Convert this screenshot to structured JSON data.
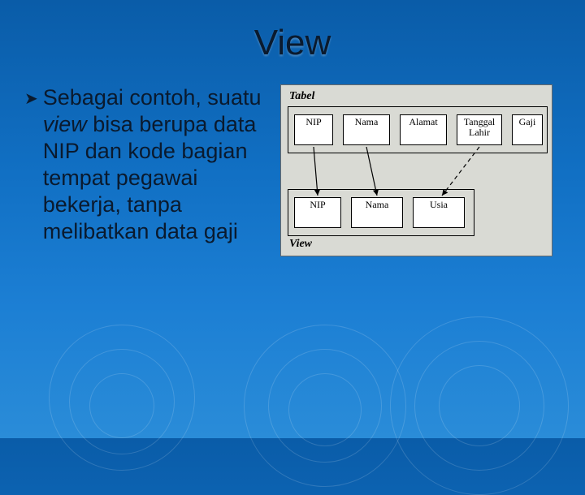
{
  "title": "View",
  "bullet": {
    "lead": "Sebagai contoh, suatu ",
    "italic": "view",
    "rest": " bisa berupa data NIP dan kode bagian tempat pegawai bekerja, tanpa melibatkan data gaji"
  },
  "diagram": {
    "labelTop": "Tabel",
    "labelBottom": "View",
    "topCells": {
      "nip": "NIP",
      "nama": "Nama",
      "alamat": "Alamat",
      "tgl": "Tanggal Lahir",
      "gaji": "Gaji"
    },
    "bottomCells": {
      "nip": "NIP",
      "nama": "Nama",
      "usia": "Usia"
    }
  }
}
